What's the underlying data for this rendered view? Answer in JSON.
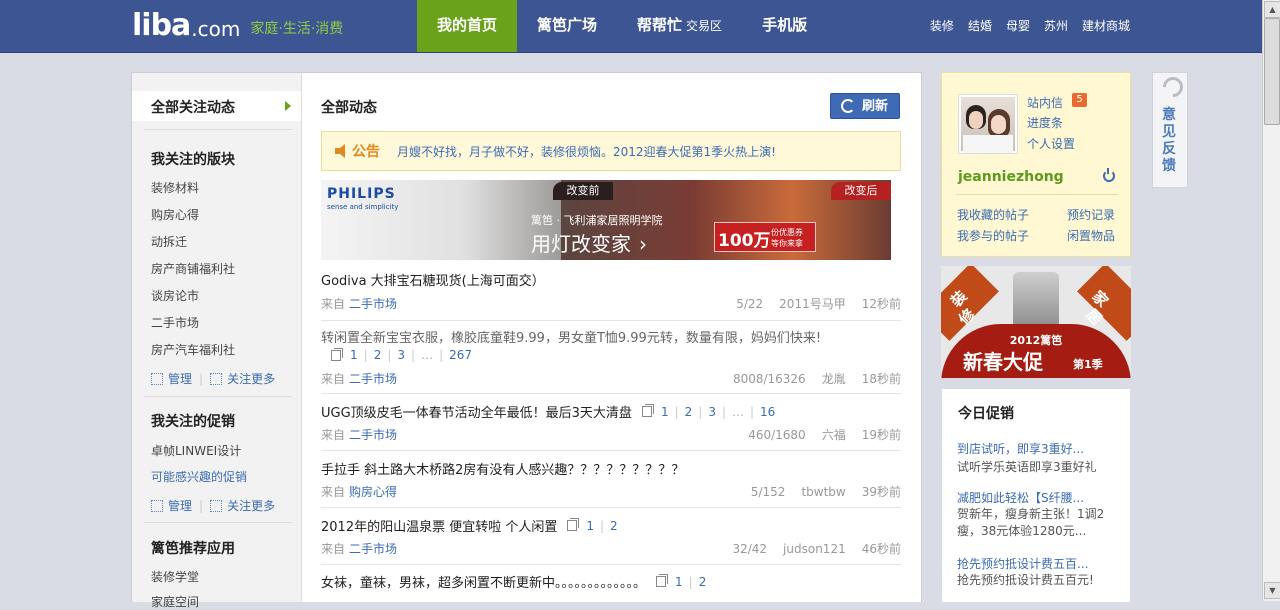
{
  "header": {
    "logo_main": "liba",
    "logo_com": ".com",
    "slogan": "家庭·生活·消费",
    "nav": [
      {
        "label": "我的首页",
        "sub": ""
      },
      {
        "label": "篱笆广场",
        "sub": ""
      },
      {
        "label": "帮帮忙",
        "sub": "交易区"
      },
      {
        "label": "手机版",
        "sub": ""
      }
    ],
    "links": [
      "装修",
      "结婚",
      "母婴",
      "苏州",
      "建材商城"
    ]
  },
  "sidebar": {
    "all_follow": "全部关注动态",
    "boards_title": "我关注的版块",
    "boards": [
      "装修材料",
      "购房心得",
      "动拆迁",
      "房产商铺福利社",
      "谈房论市",
      "二手市场",
      "房产汽车福利社"
    ],
    "manage": "管理",
    "follow_more": "关注更多",
    "promos_title": "我关注的促销",
    "promos": [
      "卓帧LINWEI设计",
      "可能感兴趣的促销"
    ],
    "apps_title": "篱笆推荐应用",
    "apps": [
      "装修学堂",
      "家庭空间"
    ]
  },
  "feed": {
    "title": "全部动态",
    "refresh": "刷新",
    "notice_label": "公告",
    "notice_text": "月嫂不好找，月子做不好，装修很烦恼。2012迎春大促第1季火热上演!",
    "banner": {
      "brand": "PHILIPS",
      "tagline": "sense and simplicity",
      "before": "改变前",
      "after": "改变后",
      "sub": "篱笆 · 飞利浦家居照明学院",
      "headline": "用灯改变家",
      "coupon_amount": "100万",
      "coupon_l1": "份优惠券",
      "coupon_l2": "等你来拿"
    },
    "from_label": "来自",
    "posts": [
      {
        "title": "Godiva 大排宝石糖现货(上海可面交）",
        "pages": [],
        "source": "二手市场",
        "date": "5/22",
        "author": "2011号马甲",
        "time": "12秒前"
      },
      {
        "title": "转闲置全新宝宝衣服，橡胶底童鞋9.99，男女童T恤9.99元转，数量有限，妈妈们快来!",
        "pages": [
          "1",
          "2",
          "3",
          "…",
          "267"
        ],
        "source": "二手市场",
        "date": "8008/16326",
        "author": "龙胤",
        "time": "18秒前"
      },
      {
        "title": "UGG顶级皮毛一体春节活动全年最低！最后3天大清盘",
        "pages": [
          "1",
          "2",
          "3",
          "…",
          "16"
        ],
        "source": "二手市场",
        "date": "460/1680",
        "author": "六福",
        "time": "19秒前"
      },
      {
        "title": "手拉手 斜土路大木桥路2房有没有人感兴趣？？？？？？？？？",
        "pages": [],
        "source": "购房心得",
        "date": "5/152",
        "author": "tbwtbw",
        "time": "39秒前"
      },
      {
        "title": "2012年的阳山温泉票 便宜转啦 个人闲置",
        "pages": [
          "1",
          "2"
        ],
        "source": "二手市场",
        "date": "32/42",
        "author": "judson121",
        "time": "46秒前"
      },
      {
        "title": "女袜，童袜，男袜，超多闲置不断更新中。。。。。。。。。。。。。",
        "pages": [
          "1",
          "2"
        ],
        "source": "",
        "date": "",
        "author": "",
        "time": ""
      }
    ]
  },
  "profile": {
    "links": [
      "站内信",
      "进度条",
      "个人设置"
    ],
    "badge": "5",
    "username": "jeanniezhong",
    "bottom_links": [
      "我收藏的帖子",
      "预约记录",
      "我参与的帖子",
      "闲置物品"
    ]
  },
  "promo": {
    "left1": "装",
    "left2": "修",
    "right1": "家",
    "right2": "居",
    "year": "2012篱笆",
    "headline": "新春大促",
    "season": "第1季"
  },
  "today": {
    "title": "今日促销",
    "items": [
      {
        "t": "到店试听，即享3重好...",
        "d": "试听学乐英语即享3重好礼"
      },
      {
        "t": "减肥如此轻松【S纤腰...",
        "d": "贺新年，瘦身新主张！1调2瘦，38元体验1280元..."
      },
      {
        "t": "抢先预约抵设计费五百...",
        "d": "抢先预约抵设计费五百元!"
      }
    ]
  },
  "feedback": "意见反馈"
}
